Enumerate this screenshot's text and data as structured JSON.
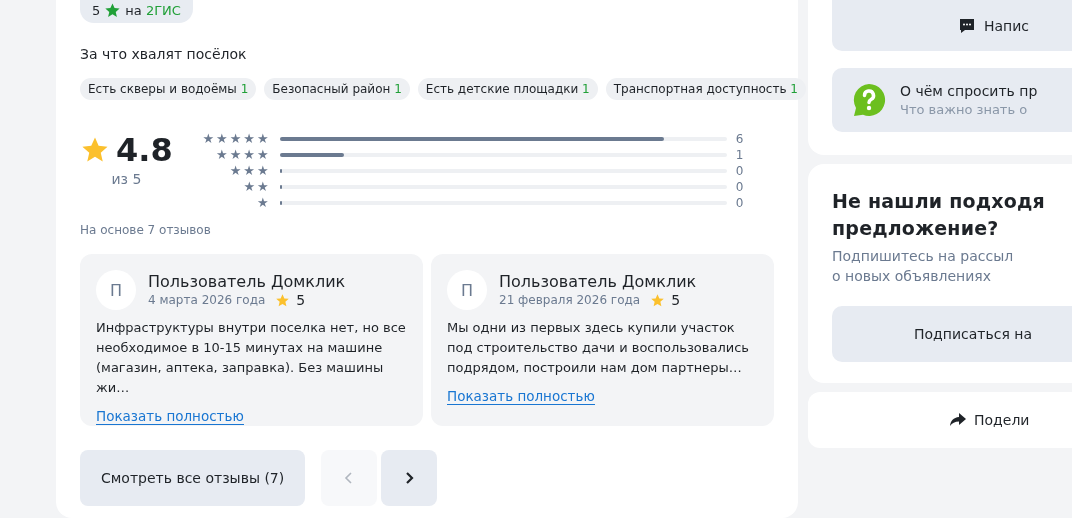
{
  "source_chip": {
    "rating": "5",
    "prefix": "на",
    "brand": "2ГИС"
  },
  "praise": {
    "title": "За что хвалят посёлок",
    "tags": [
      {
        "label": "Есть скверы и водоёмы",
        "count": "1"
      },
      {
        "label": "Безопасный район",
        "count": "1"
      },
      {
        "label": "Есть детские площадки",
        "count": "1"
      },
      {
        "label": "Транспортная доступность",
        "count": "1"
      }
    ]
  },
  "summary": {
    "score": "4.8",
    "scale": "из 5",
    "basis": "На основе 7 отзывов"
  },
  "distribution": [
    {
      "label": "★★★★★",
      "level": 0.86,
      "count": "6"
    },
    {
      "label": "★★★★",
      "level": 0.143,
      "count": "1"
    },
    {
      "label": "★★★",
      "level": 0,
      "count": "0"
    },
    {
      "label": "★★",
      "level": 0,
      "count": "0"
    },
    {
      "label": "★",
      "level": 0,
      "count": "0"
    }
  ],
  "reviews": [
    {
      "avatar": "П",
      "author": "Пользователь Домклик",
      "date": "4 марта 2026 года",
      "rating": "5",
      "text": "Инфраструктуры внутри поселка нет, но все необходимое в 10-15 минутах на машине (магазин, аптека, заправка). Без машины жи…",
      "link": "Показать полностью"
    },
    {
      "avatar": "П",
      "author": "Пользователь Домклик",
      "date": "21 февраля 2026 года",
      "rating": "5",
      "text": "Мы одни из первых здесь купили участок под строительство дачи и воспользовались подрядом, построили нам дом партнеры…",
      "link": "Показать полностью"
    }
  ],
  "all_reviews_button": "Смотреть все отзывы (7)",
  "pager": {
    "prev_disabled": true,
    "next_disabled": false
  },
  "sidebar": {
    "write_button": "Напис",
    "question": {
      "title": "О чём спросить пр",
      "subtitle": "Что важно знать о"
    },
    "subscribe": {
      "title": "Не нашли подходя\nпредложение?",
      "subtitle": "Подпишитесь на рассыл\nо новых объявлениях",
      "button": "Подписаться на"
    },
    "share_button": "Подели"
  }
}
